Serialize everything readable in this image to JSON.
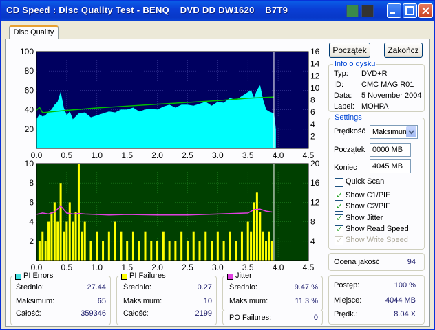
{
  "window": {
    "title": "CD Speed : Disc Quality Test - BENQ    DVD DD DW1620    B7T9"
  },
  "tabs": [
    {
      "label": "Disc Quality"
    }
  ],
  "buttons": {
    "start": "Początek",
    "finish": "Zakończ"
  },
  "disc_info": {
    "title": "Info o dysku",
    "rows": [
      {
        "label": "Typ:",
        "value": "DVD+R"
      },
      {
        "label": "ID:",
        "value": "CMC MAG R01"
      },
      {
        "label": "Data:",
        "value": "5 November 2004"
      },
      {
        "label": "Label:",
        "value": "MOHPA"
      }
    ]
  },
  "settings": {
    "title": "Settings",
    "speed_label": "Prędkość",
    "speed_value": "Maksimum",
    "start_label": "Początek",
    "start_value": "0000 MB",
    "end_label": "Koniec",
    "end_value": "4045 MB",
    "checkboxes": [
      {
        "label": "Quick Scan",
        "checked": false,
        "disabled": false
      },
      {
        "label": "Show C1/PIE",
        "checked": true,
        "disabled": false
      },
      {
        "label": "Show C2/PIF",
        "checked": true,
        "disabled": false
      },
      {
        "label": "Show Jitter",
        "checked": true,
        "disabled": false
      },
      {
        "label": "Show Read Speed",
        "checked": true,
        "disabled": false
      },
      {
        "label": "Show Write Speed",
        "checked": true,
        "disabled": true
      }
    ]
  },
  "quality": {
    "label": "Ocena jakość",
    "value": "94"
  },
  "progress": {
    "rows": [
      {
        "label": "Postęp:",
        "value": "100 %"
      },
      {
        "label": "Miejsce:",
        "value": "4044 MB"
      },
      {
        "label": "Prędk.:",
        "value": "8.04 X"
      }
    ]
  },
  "pi_errors": {
    "title": "PI Errors",
    "color": "#40e0e0",
    "rows": [
      {
        "label": "Średnio:",
        "value": "27.44"
      },
      {
        "label": "Maksimum:",
        "value": "65"
      },
      {
        "label": "Całość:",
        "value": "359346"
      }
    ]
  },
  "pi_failures": {
    "title": "PI Failures",
    "color": "#ffff00",
    "rows": [
      {
        "label": "Średnio:",
        "value": "0.27"
      },
      {
        "label": "Maksimum:",
        "value": "10"
      },
      {
        "label": "Całość:",
        "value": "2199"
      }
    ]
  },
  "jitter": {
    "title": "Jitter",
    "color": "#e040e0",
    "rows": [
      {
        "label": "Średnio:",
        "value": "9.47 %"
      },
      {
        "label": "Maksimum:",
        "value": "11.3 %"
      }
    ]
  },
  "po_failures": {
    "label": "PO Failures:",
    "value": "0"
  },
  "chart_data": [
    {
      "type": "area",
      "x_ticks": [
        "0.0",
        "0.5",
        "1.0",
        "1.5",
        "2.0",
        "2.5",
        "3.0",
        "3.5",
        "4.0",
        "4.5"
      ],
      "xlim": [
        0,
        4.5
      ],
      "y_left_ticks": [
        "20",
        "40",
        "60",
        "80",
        "100"
      ],
      "y_left_lim": [
        0,
        100
      ],
      "y_right_ticks": [
        "2",
        "4",
        "6",
        "8",
        "10",
        "12",
        "14",
        "16"
      ],
      "y_right_lim": [
        0,
        16
      ],
      "grid": true,
      "series": [
        {
          "color": "#00ffff",
          "x": [
            0.0,
            0.05,
            0.1,
            0.15,
            0.2,
            0.25,
            0.3,
            0.35,
            0.4,
            0.45,
            0.5,
            0.55,
            0.6,
            0.7,
            0.8,
            0.9,
            1.0,
            1.1,
            1.2,
            1.3,
            1.4,
            1.5,
            1.6,
            1.7,
            1.8,
            1.9,
            2.0,
            2.1,
            2.2,
            2.3,
            2.4,
            2.5,
            2.6,
            2.7,
            2.8,
            2.9,
            3.0,
            3.1,
            3.2,
            3.3,
            3.4,
            3.5,
            3.55,
            3.6,
            3.65,
            3.7,
            3.75,
            3.8,
            3.85,
            3.93,
            3.96
          ],
          "values": [
            30,
            35,
            33,
            34,
            38,
            40,
            45,
            48,
            58,
            42,
            34,
            38,
            30,
            36,
            37,
            32,
            34,
            36,
            38,
            37,
            40,
            40,
            42,
            38,
            40,
            41,
            40,
            43,
            45,
            42,
            45,
            45,
            44,
            46,
            48,
            44,
            48,
            47,
            52,
            50,
            54,
            58,
            60,
            52,
            60,
            65,
            50,
            40,
            38,
            36,
            20
          ]
        },
        {
          "color": "#00c000",
          "axis": "right",
          "x": [
            0.0,
            0.05,
            0.1,
            0.5,
            1.0,
            1.5,
            2.0,
            2.5,
            3.0,
            3.5,
            3.93
          ],
          "values": [
            6.3,
            6.8,
            5.9,
            6.3,
            6.7,
            7.0,
            7.3,
            7.6,
            7.9,
            8.3,
            8.5
          ]
        }
      ]
    },
    {
      "type": "bar",
      "x_ticks": [
        "0.0",
        "0.5",
        "1.0",
        "1.5",
        "2.0",
        "2.5",
        "3.0",
        "3.5",
        "4.0",
        "4.5"
      ],
      "xlim": [
        0,
        4.5
      ],
      "y_left_ticks": [
        "2",
        "4",
        "6",
        "8",
        "10"
      ],
      "y_left_lim": [
        0,
        10
      ],
      "y_right_ticks": [
        "4",
        "8",
        "12",
        "16",
        "20"
      ],
      "y_right_lim": [
        0,
        20
      ],
      "grid": true,
      "series": [
        {
          "color": "#ffff00",
          "x": [
            0.05,
            0.1,
            0.15,
            0.2,
            0.25,
            0.3,
            0.35,
            0.4,
            0.45,
            0.5,
            0.55,
            0.6,
            0.65,
            0.7,
            0.75,
            0.8,
            0.9,
            1.0,
            1.1,
            1.2,
            1.3,
            1.4,
            1.5,
            1.6,
            1.7,
            1.8,
            1.9,
            2.0,
            2.1,
            2.2,
            2.3,
            2.4,
            2.5,
            2.6,
            2.7,
            2.8,
            2.9,
            3.0,
            3.1,
            3.2,
            3.3,
            3.4,
            3.5,
            3.55,
            3.6,
            3.65,
            3.7,
            3.75,
            3.8,
            3.85,
            3.9
          ],
          "values": [
            2,
            3,
            2,
            4,
            5,
            6,
            4,
            8,
            3,
            4,
            6,
            4,
            5,
            10,
            3,
            4,
            2,
            3,
            2,
            3,
            4,
            3,
            2,
            3,
            2,
            3,
            2,
            2,
            3,
            2,
            2,
            3,
            2,
            3,
            2,
            3,
            2,
            3,
            2,
            3,
            2,
            3,
            4,
            3,
            6,
            7,
            5,
            3,
            2,
            3,
            2
          ]
        },
        {
          "color": "#e040e0",
          "axis": "right",
          "x": [
            0.0,
            0.1,
            0.2,
            0.3,
            0.4,
            0.5,
            0.6,
            0.7,
            0.8,
            1.0,
            1.2,
            1.5,
            2.0,
            2.5,
            3.0,
            3.5,
            3.6,
            3.7,
            3.8,
            3.9
          ],
          "values": [
            9.5,
            9.8,
            9.6,
            10.0,
            11.3,
            9.8,
            9.6,
            9.7,
            9.6,
            9.5,
            9.4,
            9.5,
            9.4,
            9.4,
            9.6,
            9.8,
            10.5,
            10.6,
            10.2,
            10.0
          ]
        }
      ]
    }
  ]
}
